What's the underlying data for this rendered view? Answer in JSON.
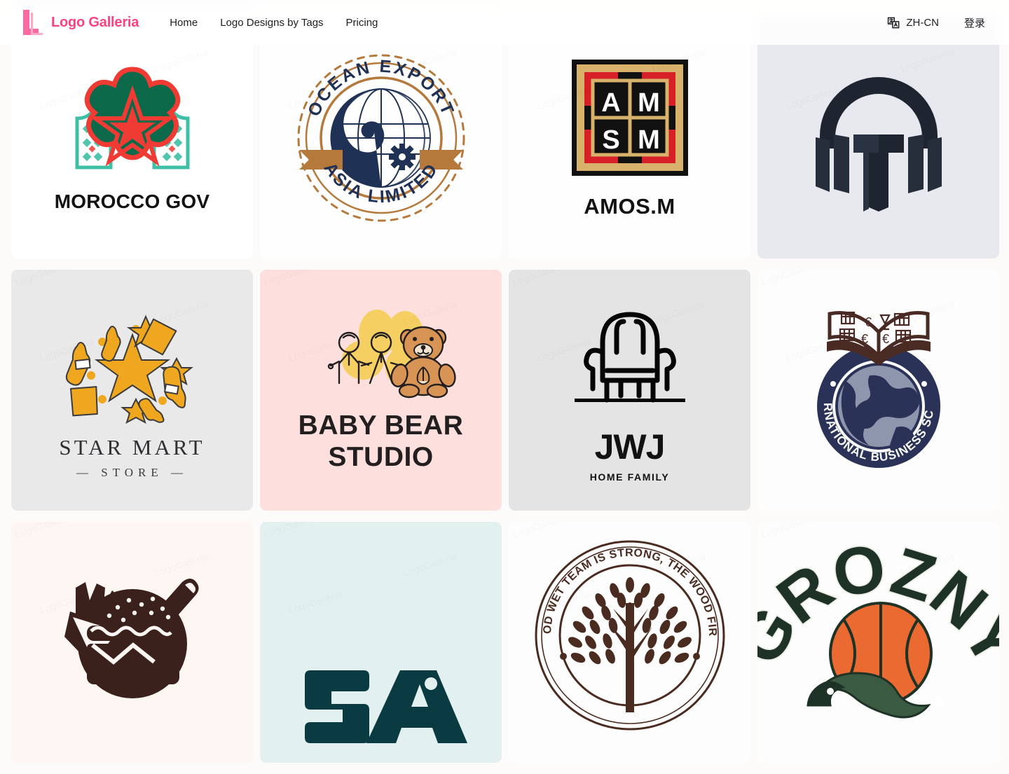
{
  "header": {
    "brand_name": "Logo Galleria",
    "brand_mark_icon": "letter-l-logo-icon",
    "brand_color": "#f8437f",
    "nav": [
      {
        "label": "Home"
      },
      {
        "label": "Logo Designs by Tags"
      },
      {
        "label": "Pricing"
      }
    ],
    "language": {
      "icon": "translate-icon",
      "label": "ZH-CN"
    },
    "login_label": "登录"
  },
  "watermark_text": "LogoGalleria",
  "gallery": {
    "sliver_row": [
      {
        "bg": "#eceef3"
      },
      {
        "bg": "#f7f7ef"
      },
      {
        "bg": "#fdfbf9"
      },
      {
        "bg": "#fdfbf9"
      }
    ],
    "rows": [
      [
        {
          "name": "morocco-gov",
          "title": "MOROCCO GOV",
          "bg": "#ffffff",
          "colors": {
            "primary": "#0c6a4b",
            "secondary": "#ef3b33",
            "accent": "#3fc0a6"
          }
        },
        {
          "name": "ocean-export-asia-limited",
          "title_top": "OCEAN EXPORT",
          "title_bottom": "ASIA LIMITED",
          "bg": "#fefefe",
          "colors": {
            "primary": "#1f3154",
            "secondary": "#b5793b"
          }
        },
        {
          "name": "amos-m",
          "title": "AMOS.M",
          "letters": [
            "A",
            "M",
            "S",
            "M"
          ],
          "bg": "#fefefe",
          "colors": {
            "primary": "#111111",
            "secondary": "#d8b16a",
            "accent": "#d61f26"
          }
        },
        {
          "name": "headphone-t",
          "title": "",
          "bg": "#e8e8ef",
          "colors": {
            "primary": "#1e2430"
          }
        }
      ],
      [
        {
          "name": "star-mart-store",
          "title": "STAR MART",
          "subtitle": "— STORE —",
          "bg": "#e9e9ea",
          "colors": {
            "primary": "#efa720",
            "secondary": "#3b3b3b"
          }
        },
        {
          "name": "baby-bear-studio",
          "title": "BABY BEAR",
          "subtitle": "STUDIO",
          "bg": "#fde0dd",
          "colors": {
            "primary": "#f6cf62",
            "secondary": "#d79455",
            "accent": "#231f20"
          }
        },
        {
          "name": "jwj-home-family",
          "title": "JWJ",
          "subtitle": "HOME FAMILY",
          "bg": "#e4e4e5",
          "colors": {
            "primary": "#050505"
          }
        },
        {
          "name": "international-business-school",
          "title": "INTERNATIONAL BUSINESS SCHOOL",
          "bg": "#fdfdfd",
          "colors": {
            "primary": "#2b3257",
            "secondary": "#4a2b24",
            "accent": "#8e96ae"
          }
        }
      ],
      [
        {
          "name": "burger-fries-badge",
          "title": "",
          "bg": "#fdf6f3",
          "colors": {
            "primary": "#3b211c"
          }
        },
        {
          "name": "five-a-mark",
          "title": "5A",
          "bg": "#e2f0ef",
          "colors": {
            "primary": "#0a3b42"
          }
        },
        {
          "name": "wood-team-tree-badge",
          "title": "THE WOOD WET TEAM IS STRONG, THE WOOD FIRE TEAM",
          "bg": "#fdfdfd",
          "colors": {
            "primary": "#4a2b20"
          }
        },
        {
          "name": "grozny-basketball",
          "title": "GROZNY",
          "bg": "#fdfdfd",
          "colors": {
            "primary": "#1e3225",
            "secondary": "#ea6a32",
            "accent": "#e9ece4"
          }
        }
      ]
    ]
  }
}
